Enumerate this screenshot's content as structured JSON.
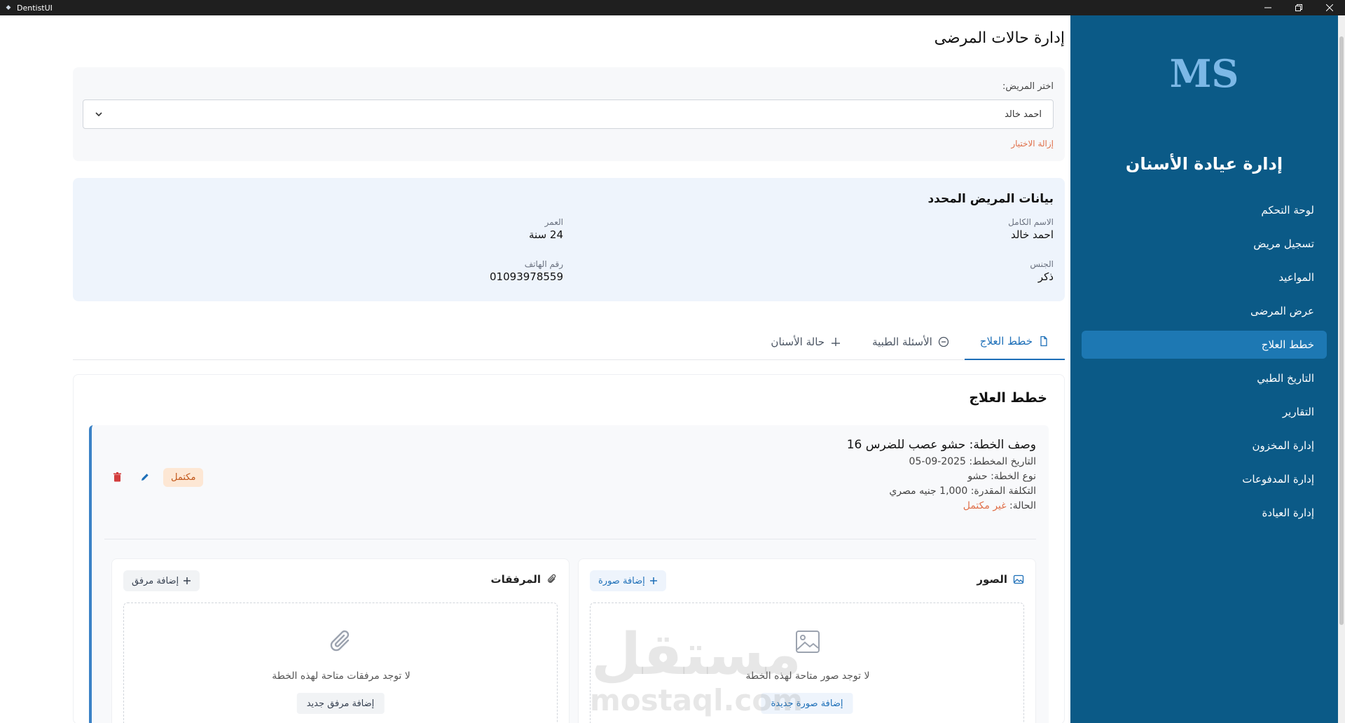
{
  "window": {
    "title": "DentistUI"
  },
  "sidebar": {
    "logo_text": "MS",
    "title": "إدارة عيادة الأسنان",
    "items": [
      {
        "label": "لوحة التحكم"
      },
      {
        "label": "تسجيل مريض"
      },
      {
        "label": "المواعيد"
      },
      {
        "label": "عرض المرضى"
      },
      {
        "label": "خطط العلاج"
      },
      {
        "label": "التاريخ الطبي"
      },
      {
        "label": "التقارير"
      },
      {
        "label": "إدارة المخزون"
      },
      {
        "label": "إدارة المدفوعات"
      },
      {
        "label": "إدارة العيادة"
      }
    ],
    "active_index": 4
  },
  "main": {
    "page_title": "إدارة حالات المرضى",
    "select": {
      "label": "اختر المريض:",
      "value": "احمد خالد",
      "clear": "إزالة الاختيار"
    },
    "patient_info": {
      "title": "بيانات المريض المحدد",
      "name_label": "الاسم الكامل",
      "name_value": "احمد خالد",
      "age_label": "العمر",
      "age_value": "24 سنة",
      "gender_label": "الجنس",
      "gender_value": "ذكر",
      "phone_label": "رقم الهاتف",
      "phone_value": "01093978559"
    },
    "tabs": [
      {
        "label": "خطط العلاج",
        "icon": "document-icon"
      },
      {
        "label": "الأسئلة الطبية",
        "icon": "circle-icon"
      },
      {
        "label": "حالة الأسنان",
        "icon": "plus-icon"
      }
    ],
    "panel": {
      "title": "خطط العلاج",
      "plan": {
        "description": "وصف الخطة: حشو عصب للضرس 16",
        "date": "التاريخ المخطط: 2025-09-05",
        "type": "نوع الخطة: حشو",
        "cost": "التكلفة المقدرة: 1,000 جنيه مصري",
        "status_label": "الحالة:",
        "status_value": "غير مكتمل",
        "badge": "مكتمل"
      },
      "images": {
        "title": "الصور",
        "add_label": "إضافة صورة",
        "empty_text": "لا توجد صور متاحة لهذه الخطة",
        "empty_button": "إضافة صورة جديدة"
      },
      "attachments": {
        "title": "المرفقات",
        "add_label": "إضافة مرفق",
        "empty_text": "لا توجد مرفقات متاحة لهذه الخطة",
        "empty_button": "إضافة مرفق جديد"
      }
    }
  },
  "watermark": {
    "arabic": "مستقل",
    "latin": "mostaql.com"
  },
  "colors": {
    "sidebar_bg": "#0b5a87",
    "sidebar_active": "#1d78b3",
    "accent": "#1d6fb8",
    "warning": "#e0704a",
    "info_bg": "#eef4fc"
  }
}
